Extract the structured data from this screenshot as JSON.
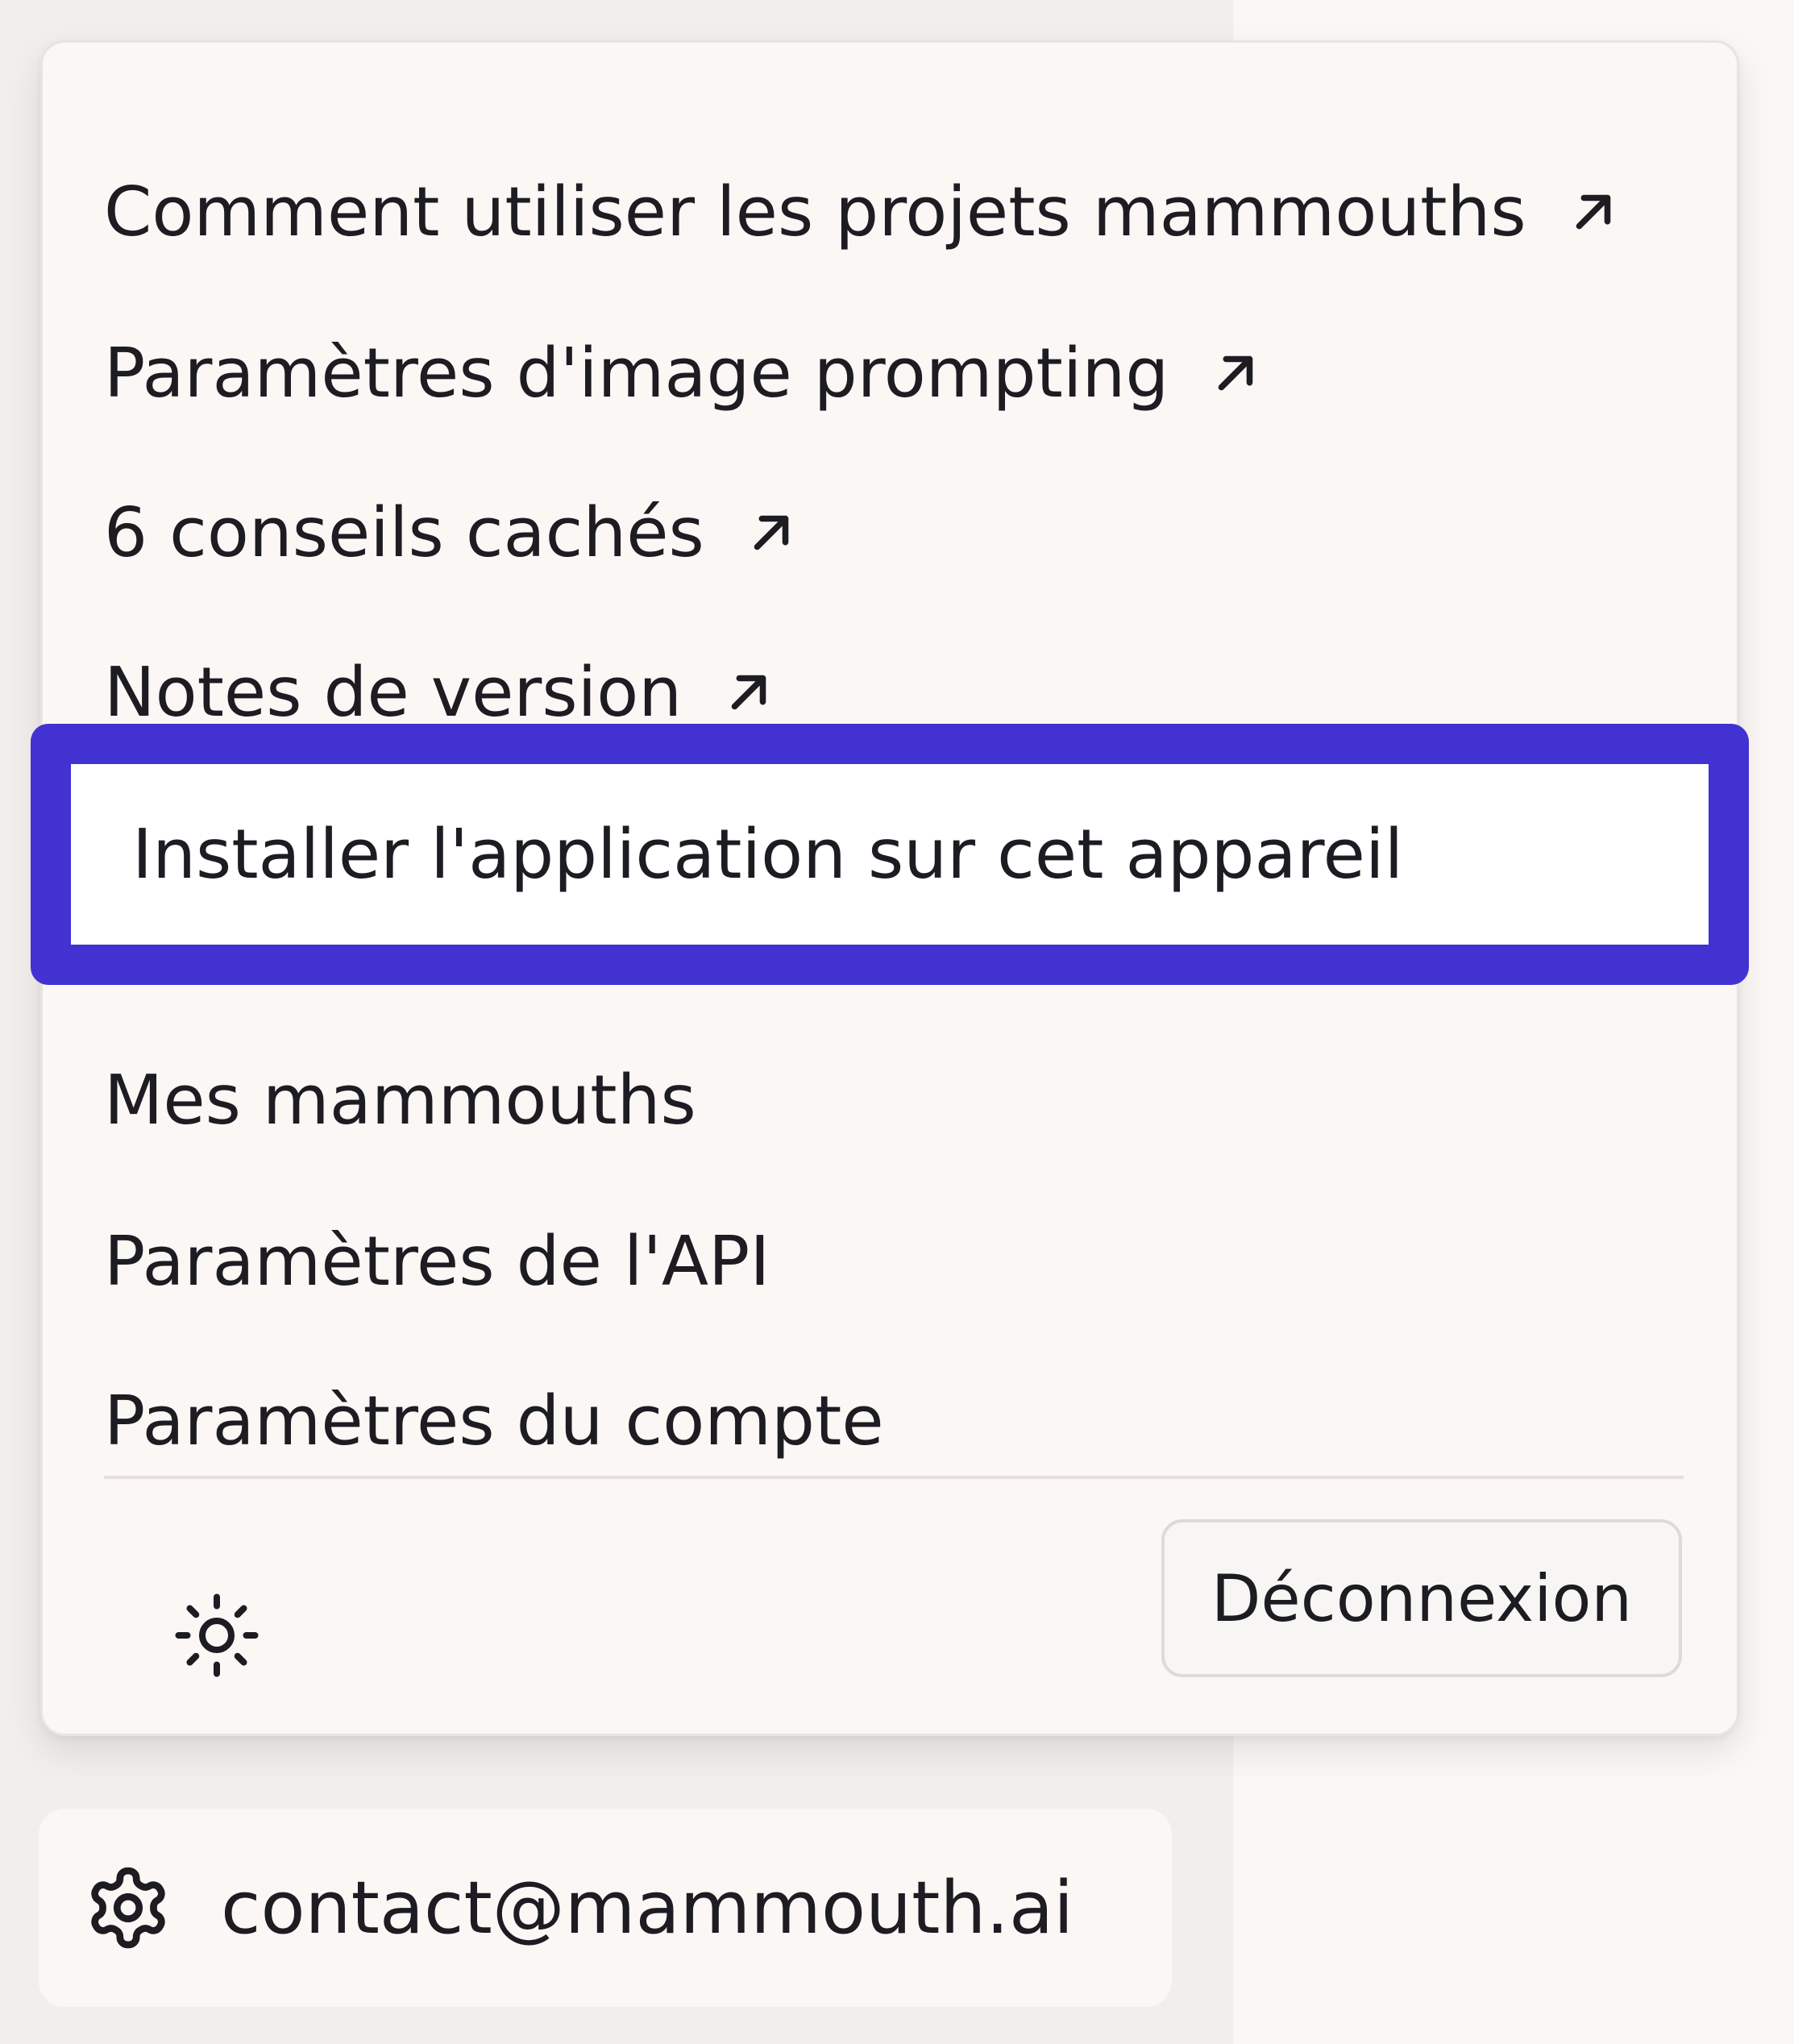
{
  "menu": {
    "external_links": [
      {
        "label": "Comment utiliser les projets mammouths",
        "icon": "arrow-up-right-icon"
      },
      {
        "label": "Paramètres d'image prompting",
        "icon": "arrow-up-right-icon"
      },
      {
        "label": "6 conseils cachés",
        "icon": "arrow-up-right-icon"
      },
      {
        "label": "Notes de version",
        "icon": "arrow-up-right-icon"
      }
    ],
    "highlighted_item": {
      "label": "Installer l'application sur cet appareil"
    },
    "items": [
      {
        "label": "Mes mammouths"
      },
      {
        "label": "Paramètres de l'API"
      },
      {
        "label": "Paramètres du compte"
      }
    ],
    "footer": {
      "theme_icon": "sun-icon",
      "logout_label": "Déconnexion"
    }
  },
  "account": {
    "icon": "gear-icon",
    "email": "contact@mammouth.ai"
  },
  "colors": {
    "highlight_border": "#4232d2",
    "background": "#faf7f5",
    "sidebar": "#f2eeeb",
    "text": "#1c1c22"
  }
}
